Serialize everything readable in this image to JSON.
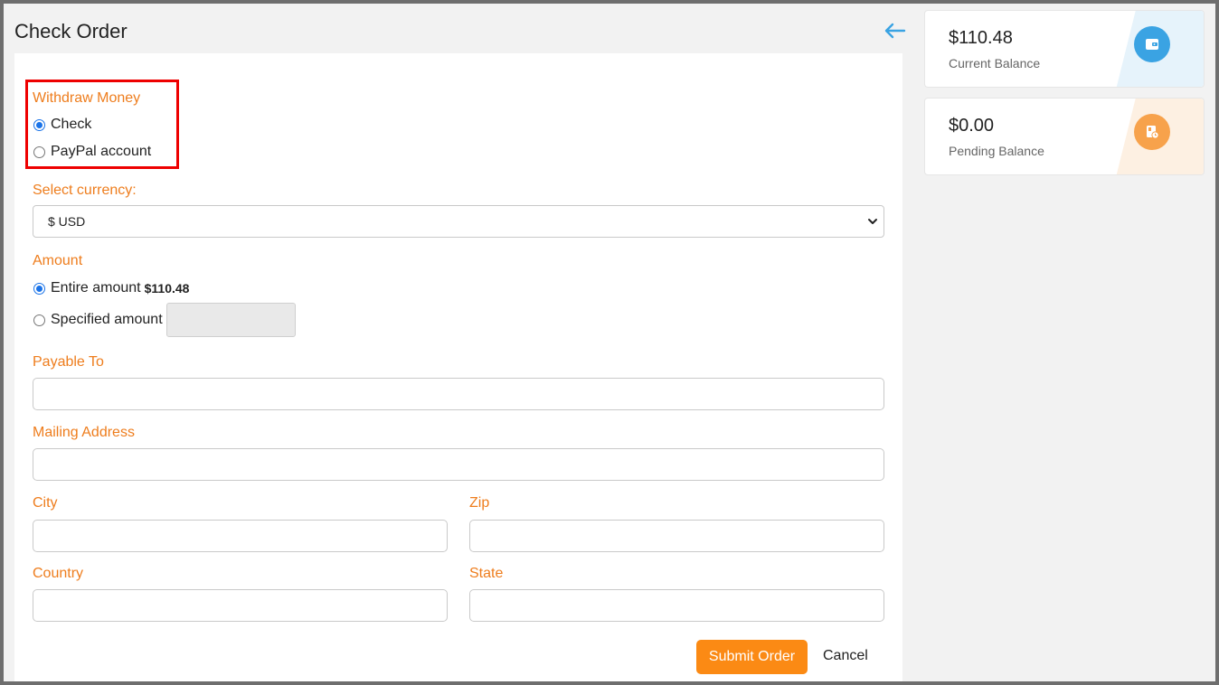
{
  "page": {
    "title": "Check Order"
  },
  "form": {
    "withdraw_label": "Withdraw Money",
    "methods": [
      {
        "label": "Check",
        "checked": true
      },
      {
        "label": "PayPal account",
        "checked": false
      }
    ],
    "currency_label": "Select currency:",
    "currency_value": "$ USD",
    "amount_label": "Amount",
    "entire_amount_label": "Entire amount",
    "entire_amount_value": "$110.48",
    "specified_amount_label": "Specified amount",
    "payable_to_label": "Payable To",
    "mailing_address_label": "Mailing Address",
    "city_label": "City",
    "zip_label": "Zip",
    "country_label": "Country",
    "state_label": "State",
    "submit_label": "Submit Order",
    "cancel_label": "Cancel"
  },
  "balances": {
    "current": {
      "amount": "$110.48",
      "caption": "Current Balance",
      "icon": "wallet-icon",
      "color": "#3aa3e3",
      "shade": "#e6f3fb"
    },
    "pending": {
      "amount": "$0.00",
      "caption": "Pending Balance",
      "icon": "pending-icon",
      "color": "#f7a24b",
      "shade": "#fdf0e2"
    }
  },
  "colors": {
    "accent": "#ee7d1d",
    "button": "#fb8a14",
    "highlight": "#ee0000",
    "back_arrow": "#3aa3e3"
  }
}
